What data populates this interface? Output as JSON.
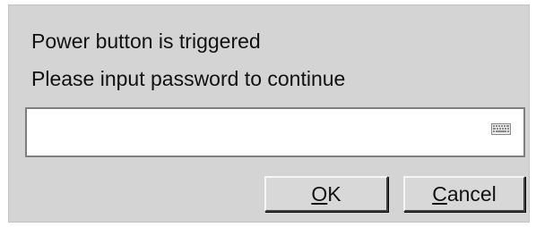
{
  "dialog": {
    "message_line1": "Power button is triggered",
    "message_line2": "Please input password to continue",
    "password_value": "",
    "keyboard_icon": "keyboard-icon",
    "ok_mnemonic": "O",
    "ok_rest": "K",
    "cancel_mnemonic": "C",
    "cancel_rest": "ancel"
  },
  "colors": {
    "dialog_bg": "#d4d4d4",
    "field_bg": "#ffffff",
    "field_border": "#7f7f7f"
  }
}
